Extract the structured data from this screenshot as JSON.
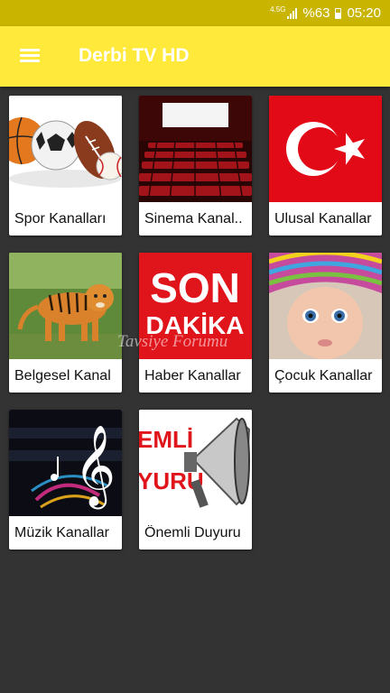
{
  "status_bar": {
    "network": "4.5G",
    "battery": "%63",
    "time": "05:20"
  },
  "app_bar": {
    "title": "Derbi TV HD",
    "menu_icon": "menu-icon"
  },
  "categories": [
    {
      "label": "Spor Kanalları"
    },
    {
      "label": "Sinema Kanal.."
    },
    {
      "label": "Ulusal Kanallar"
    },
    {
      "label": "Belgesel Kanal"
    },
    {
      "label": "Haber Kanallar"
    },
    {
      "label": "Çocuk Kanallar"
    },
    {
      "label": "Müzik Kanallar"
    },
    {
      "label": "Önemli Duyuru"
    }
  ],
  "thumb_text": {
    "son": "SON",
    "dakika": "DAKİKA",
    "emli": "EMLİ",
    "yuru": "YURU"
  },
  "watermark": "Tavsiye Forumu",
  "colors": {
    "appbar": "#FFE93B",
    "statusbar": "#C9B500",
    "background": "#333333"
  }
}
